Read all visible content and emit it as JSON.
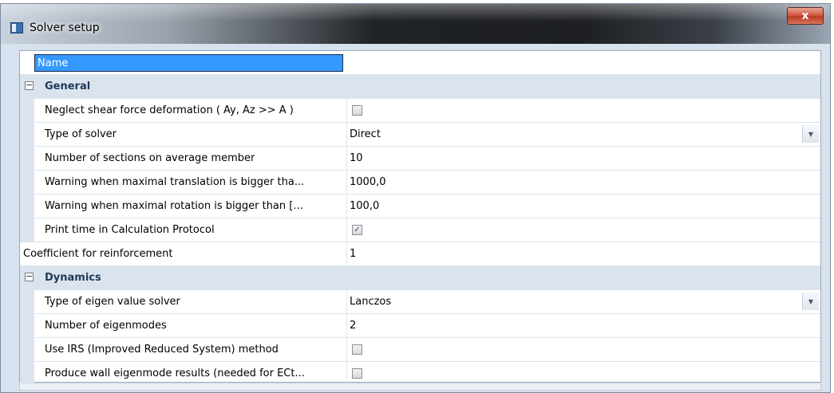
{
  "window": {
    "title": "Solver setup",
    "close_label": "x"
  },
  "grid": {
    "header_label": "Name",
    "groups": {
      "general": {
        "label": "General",
        "toggle": "−",
        "rows": [
          {
            "label": "Neglect shear force deformation ( Ay, Az >> A )",
            "value": "",
            "checked": false
          },
          {
            "label": "Type of solver",
            "value": "Direct"
          },
          {
            "label": "Number of sections on average member",
            "value": "10"
          },
          {
            "label": "Warning when maximal translation is bigger tha...",
            "value": "1000,0"
          },
          {
            "label": "Warning when maximal rotation is bigger than [...",
            "value": "100,0"
          },
          {
            "label": "Print time in Calculation Protocol",
            "value": "",
            "checked": true
          }
        ]
      },
      "standalone": {
        "label": "Coefficient for reinforcement",
        "value": "1"
      },
      "dynamics": {
        "label": "Dynamics",
        "toggle": "−",
        "rows": [
          {
            "label": "Type of eigen value solver",
            "value": "Lanczos"
          },
          {
            "label": "Number of eigenmodes",
            "value": "2"
          },
          {
            "label": "Use IRS (Improved Reduced System) method",
            "value": "",
            "checked": false
          },
          {
            "label": "Produce wall eigenmode results (needed for ECt...",
            "value": "",
            "checked": false
          }
        ]
      }
    },
    "checkmark": "✓"
  }
}
